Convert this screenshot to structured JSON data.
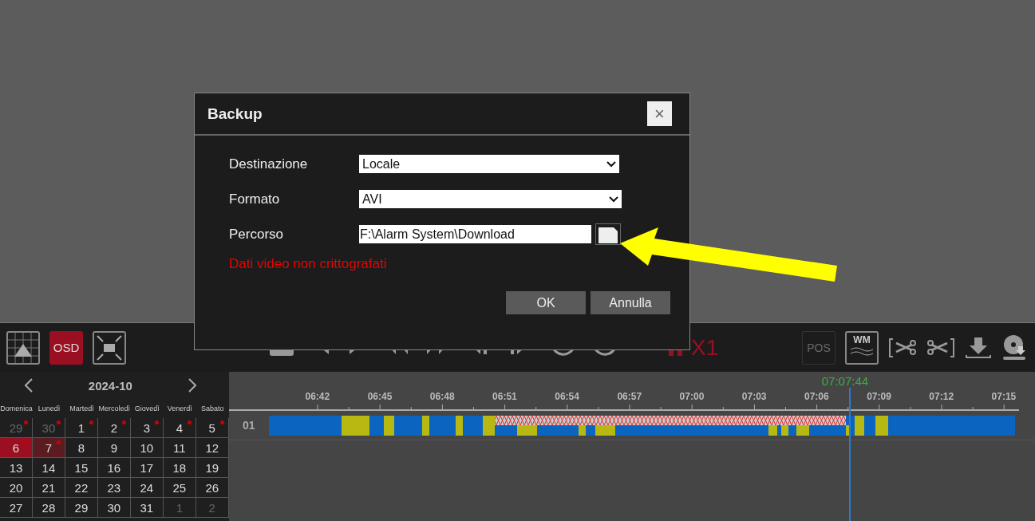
{
  "toolbar": {
    "osd_label": "OSD",
    "speed_label": "X1",
    "pos_label": "POS",
    "pos_disabled": true,
    "wm_label": "WM"
  },
  "calendar": {
    "month": "2024-10",
    "weekdays": [
      "Domenica",
      "Lunedì",
      "Martedì",
      "Mercoledì",
      "Giovedì",
      "Venerdì",
      "Sabato"
    ],
    "days": [
      {
        "label": "29",
        "muted": true,
        "selected": false,
        "highlighted": false,
        "marked": true
      },
      {
        "label": "30",
        "muted": true,
        "selected": false,
        "highlighted": false,
        "marked": true
      },
      {
        "label": "1",
        "muted": false,
        "selected": false,
        "highlighted": false,
        "marked": true
      },
      {
        "label": "2",
        "muted": false,
        "selected": false,
        "highlighted": false,
        "marked": true
      },
      {
        "label": "3",
        "muted": false,
        "selected": false,
        "highlighted": false,
        "marked": true
      },
      {
        "label": "4",
        "muted": false,
        "selected": false,
        "highlighted": false,
        "marked": true
      },
      {
        "label": "5",
        "muted": false,
        "selected": false,
        "highlighted": false,
        "marked": true
      },
      {
        "label": "6",
        "muted": false,
        "selected": true,
        "highlighted": false,
        "marked": true
      },
      {
        "label": "7",
        "muted": false,
        "selected": false,
        "highlighted": true,
        "marked": true
      },
      {
        "label": "8",
        "muted": false,
        "selected": false,
        "highlighted": false,
        "marked": false
      },
      {
        "label": "9",
        "muted": false,
        "selected": false,
        "highlighted": false,
        "marked": false
      },
      {
        "label": "10",
        "muted": false,
        "selected": false,
        "highlighted": false,
        "marked": false
      },
      {
        "label": "11",
        "muted": false,
        "selected": false,
        "highlighted": false,
        "marked": false
      },
      {
        "label": "12",
        "muted": false,
        "selected": false,
        "highlighted": false,
        "marked": false
      },
      {
        "label": "13",
        "muted": false,
        "selected": false,
        "highlighted": false,
        "marked": false
      },
      {
        "label": "14",
        "muted": false,
        "selected": false,
        "highlighted": false,
        "marked": false
      },
      {
        "label": "15",
        "muted": false,
        "selected": false,
        "highlighted": false,
        "marked": false
      },
      {
        "label": "16",
        "muted": false,
        "selected": false,
        "highlighted": false,
        "marked": false
      },
      {
        "label": "17",
        "muted": false,
        "selected": false,
        "highlighted": false,
        "marked": false
      },
      {
        "label": "18",
        "muted": false,
        "selected": false,
        "highlighted": false,
        "marked": false
      },
      {
        "label": "19",
        "muted": false,
        "selected": false,
        "highlighted": false,
        "marked": false
      },
      {
        "label": "20",
        "muted": false,
        "selected": false,
        "highlighted": false,
        "marked": false
      },
      {
        "label": "21",
        "muted": false,
        "selected": false,
        "highlighted": false,
        "marked": false
      },
      {
        "label": "22",
        "muted": false,
        "selected": false,
        "highlighted": false,
        "marked": false
      },
      {
        "label": "23",
        "muted": false,
        "selected": false,
        "highlighted": false,
        "marked": false
      },
      {
        "label": "24",
        "muted": false,
        "selected": false,
        "highlighted": false,
        "marked": false
      },
      {
        "label": "25",
        "muted": false,
        "selected": false,
        "highlighted": false,
        "marked": false
      },
      {
        "label": "26",
        "muted": false,
        "selected": false,
        "highlighted": false,
        "marked": false
      },
      {
        "label": "27",
        "muted": false,
        "selected": false,
        "highlighted": false,
        "marked": false
      },
      {
        "label": "28",
        "muted": false,
        "selected": false,
        "highlighted": false,
        "marked": false
      },
      {
        "label": "29",
        "muted": false,
        "selected": false,
        "highlighted": false,
        "marked": false
      },
      {
        "label": "30",
        "muted": false,
        "selected": false,
        "highlighted": false,
        "marked": false
      },
      {
        "label": "31",
        "muted": false,
        "selected": false,
        "highlighted": false,
        "marked": false
      },
      {
        "label": "1",
        "muted": true,
        "selected": false,
        "highlighted": false,
        "marked": false
      },
      {
        "label": "2",
        "muted": true,
        "selected": false,
        "highlighted": false,
        "marked": false
      }
    ]
  },
  "timeline": {
    "current_time": "07:07:44",
    "ticks": [
      "06:42",
      "06:45",
      "06:48",
      "06:51",
      "06:54",
      "06:57",
      "07:00",
      "07:03",
      "07:06",
      "07:09",
      "07:12",
      "07:15"
    ],
    "channel": "01"
  },
  "dialog": {
    "title": "Backup",
    "close": "×",
    "fields": [
      {
        "kind": "select",
        "label": "Destinazione",
        "value": "Locale"
      },
      {
        "kind": "select",
        "label": "Formato",
        "value": "AVI"
      },
      {
        "kind": "path",
        "label": "Percorso",
        "value": "F:\\Alarm System\\Download"
      }
    ],
    "warning": "Dati video non crittografati",
    "buttons": [
      "OK",
      "Annulla"
    ]
  }
}
